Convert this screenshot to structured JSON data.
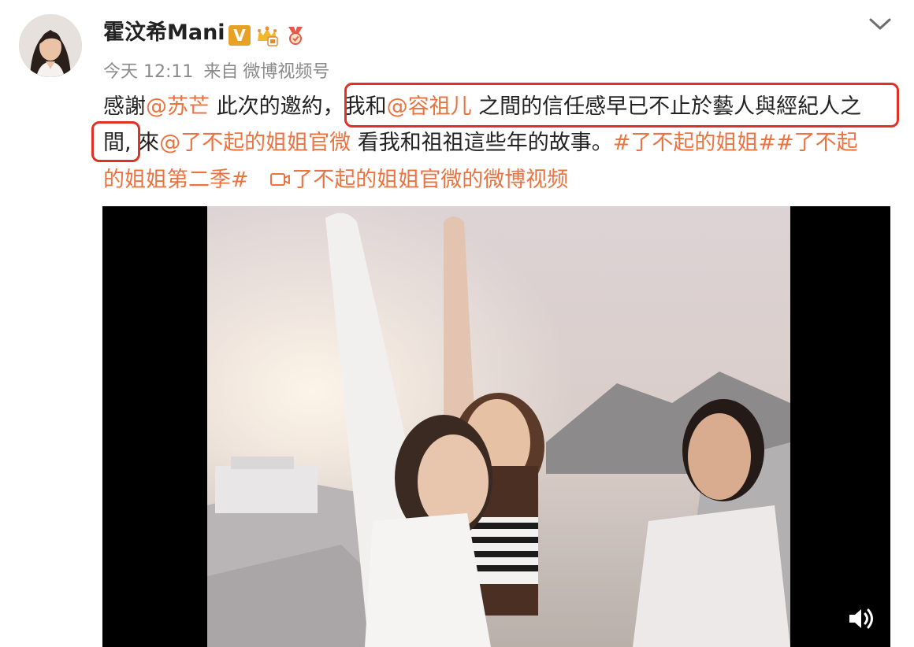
{
  "post": {
    "username": "霍汶希Mani",
    "badge_v": "V",
    "time": "今天 12:11",
    "source_prefix": "来自",
    "source": "微博视频号",
    "text": {
      "l1_a": "感謝",
      "l1_mention": "@苏芒",
      "l1_b": " 此次的邀約，",
      "l1_c": "我和",
      "l1_mention2": "@容祖儿",
      "l1_d": " 之間的信任感早已不止於藝人與經紀人之",
      "l2_a": "間,",
      "l2_b": " 來",
      "l2_mention": "@了不起的姐姐官微",
      "l2_c": " 看我和祖祖這些年的故事。",
      "l2_tag": "#了不起的姐姐##了不起",
      "l3_tag": "的姐姐第二季#",
      "l3_video_link": "了不起的姐姐官微的微博视频"
    }
  },
  "icons": [
    "avatar",
    "vip-crown-icon",
    "medal-icon",
    "chevron-down-icon",
    "video-link-icon",
    "volume-icon"
  ],
  "colors": {
    "link": "#eb7340",
    "highlight": "#e03125",
    "badge": "#e7a225"
  }
}
